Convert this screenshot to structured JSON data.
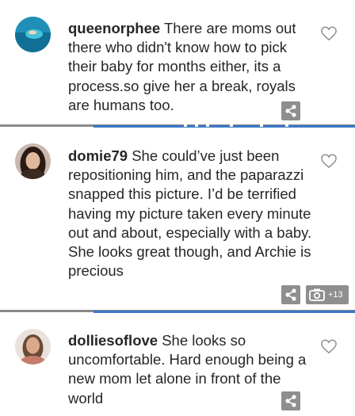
{
  "comments": [
    {
      "username": "queenorphee",
      "text": "There are moms out there who didn't know how to pick their baby for months either, its a process.so give her a break, royals are humans too.",
      "avatar_icon": "ocean-photo-avatar"
    },
    {
      "username": "domie79",
      "text": "She could’ve just been repositioning him, and the paparazzi snapped this picture. I’d be terrified having my picture taken every minute out and about, especially with a baby. She looks great though, and Archie is precious",
      "avatar_icon": "woman-portrait-avatar",
      "photo_count": "+13"
    },
    {
      "username": "dolliesoflove",
      "text": "She looks so uncomfortable. Hard enough being a new mom let alone in front of the world",
      "avatar_icon": "woman-portrait-avatar"
    }
  ],
  "icons": {
    "like": "heart-outline-icon",
    "share": "share-icon",
    "photo": "camera-icon"
  },
  "colors": {
    "icon_bg": "#8e8e8e",
    "separator_blue": "#3b77c8",
    "separator_gray": "#8a8a8a",
    "text": "#262626"
  }
}
